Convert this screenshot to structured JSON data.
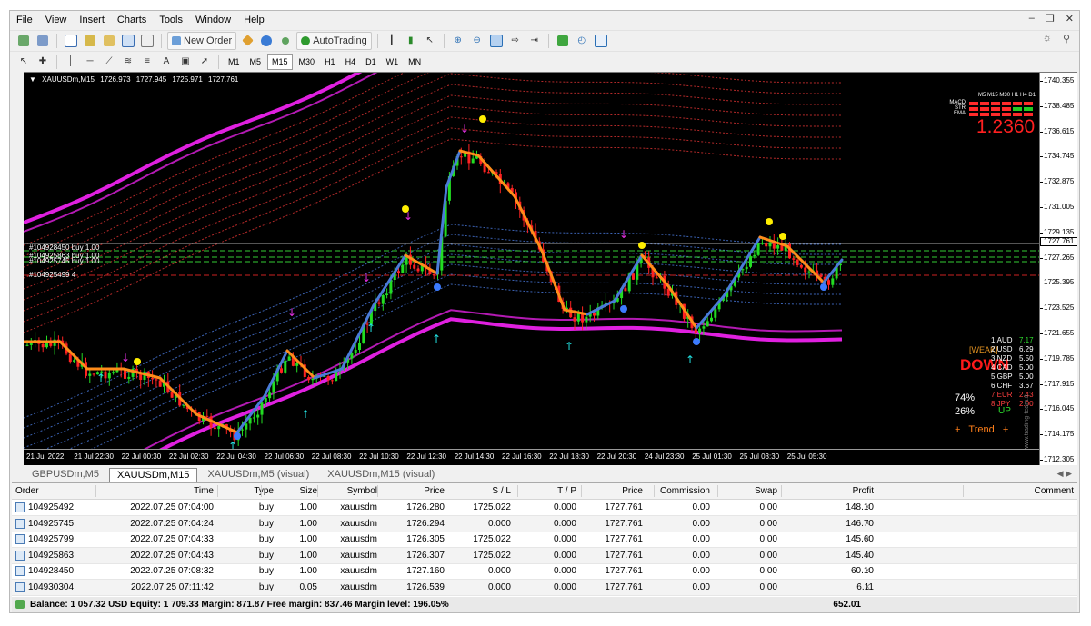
{
  "menu": [
    "File",
    "View",
    "Insert",
    "Charts",
    "Tools",
    "Window",
    "Help"
  ],
  "toolbar": {
    "new_order": "New Order",
    "autotrading": "AutoTrading"
  },
  "timeframes": [
    "M1",
    "M5",
    "M15",
    "M30",
    "H1",
    "H4",
    "D1",
    "W1",
    "MN"
  ],
  "active_timeframe": "M15",
  "chart": {
    "symbol": "XAUUSDm,M15",
    "ohlc": [
      "1726.973",
      "1727.945",
      "1725.971",
      "1727.761"
    ],
    "current_price": "1727.761",
    "price_labels": [
      "1740.355",
      "1738.485",
      "1736.615",
      "1734.745",
      "1732.875",
      "1731.005",
      "1729.135",
      "1727.265",
      "1725.395",
      "1723.525",
      "1721.655",
      "1719.785",
      "1717.915",
      "1716.045",
      "1714.175",
      "1712.305"
    ],
    "time_labels": [
      "21 Jul 2022",
      "21 Jul 22:30",
      "22 Jul 00:30",
      "22 Jul 02:30",
      "22 Jul 04:30",
      "22 Jul 06:30",
      "22 Jul 08:30",
      "22 Jul 10:30",
      "22 Jul 12:30",
      "22 Jul 14:30",
      "22 Jul 16:30",
      "22 Jul 18:30",
      "22 Jul 20:30",
      "24 Jul 23:30",
      "25 Jul 01:30",
      "25 Jul 03:30",
      "25 Jul 05:30"
    ],
    "order_labels": [
      "#104928450 buy 1.00",
      "#104925863 buy 1.00",
      "#104925745 buy 1.00",
      "#104925499 4"
    ],
    "indicator_value": "1.2360",
    "macd_rows": [
      "MACD",
      "STR",
      "EMA"
    ],
    "macd_tfs": [
      "M5",
      "M15",
      "M30",
      "H1",
      "H4",
      "D1"
    ],
    "strength_panel": {
      "header": "[WEAK]",
      "signal": "DOWN",
      "rows": [
        {
          "name": "1.AUD",
          "value": "7.17"
        },
        {
          "name": "2.USD",
          "value": "6.29"
        },
        {
          "name": "3.NZD",
          "value": "5.50"
        },
        {
          "name": "4.CAD",
          "value": "5.00"
        },
        {
          "name": "5.GBP",
          "value": "5.00"
        },
        {
          "name": "6.CHF",
          "value": "3.67"
        },
        {
          "name": "7.EUR",
          "value": "2.43"
        },
        {
          "name": "8.JPY",
          "value": "2.00"
        }
      ],
      "pct_up": "74%",
      "pct_down": "26%",
      "up_label": "UP",
      "trend_label": "+   Trend   +",
      "watermark": "www.trading-team.it"
    }
  },
  "tabs": [
    "GBPUSDm,M5",
    "XAUUSDm,M15",
    "XAUUSDm,M5 (visual)",
    "XAUUSDm,M15 (visual)"
  ],
  "active_tab": 1,
  "terminal": {
    "columns": [
      "Order",
      "Time",
      "Type",
      "Size",
      "Symbol",
      "Price",
      "S / L",
      "T / P",
      "Price",
      "Commission",
      "Swap",
      "Profit",
      "Comment"
    ],
    "rows": [
      [
        "104925492",
        "2022.07.25 07:04:00",
        "buy",
        "1.00",
        "xauusdm",
        "1726.280",
        "1725.022",
        "0.000",
        "1727.761",
        "0.00",
        "0.00",
        "148.10"
      ],
      [
        "104925745",
        "2022.07.25 07:04:24",
        "buy",
        "1.00",
        "xauusdm",
        "1726.294",
        "0.000",
        "0.000",
        "1727.761",
        "0.00",
        "0.00",
        "146.70"
      ],
      [
        "104925799",
        "2022.07.25 07:04:33",
        "buy",
        "1.00",
        "xauusdm",
        "1726.305",
        "1725.022",
        "0.000",
        "1727.761",
        "0.00",
        "0.00",
        "145.60"
      ],
      [
        "104925863",
        "2022.07.25 07:04:43",
        "buy",
        "1.00",
        "xauusdm",
        "1726.307",
        "1725.022",
        "0.000",
        "1727.761",
        "0.00",
        "0.00",
        "145.40"
      ],
      [
        "104928450",
        "2022.07.25 07:08:32",
        "buy",
        "1.00",
        "xauusdm",
        "1727.160",
        "0.000",
        "0.000",
        "1727.761",
        "0.00",
        "0.00",
        "60.10"
      ],
      [
        "104930304",
        "2022.07.25 07:11:42",
        "buy",
        "0.05",
        "xauusdm",
        "1726.539",
        "0.000",
        "0.000",
        "1727.761",
        "0.00",
        "0.00",
        "6.11"
      ]
    ],
    "balance": "Balance: 1 057.32 USD  Equity: 1 709.33  Margin: 871.87  Free margin: 837.46  Margin level: 196.05%",
    "total_profit": "652.01"
  },
  "colors": {
    "bull": "#22dd22",
    "bear": "#ff2222",
    "band": "#e020e0",
    "ma_up": "#4a7bd8",
    "ma_down": "#ff8c1a"
  }
}
